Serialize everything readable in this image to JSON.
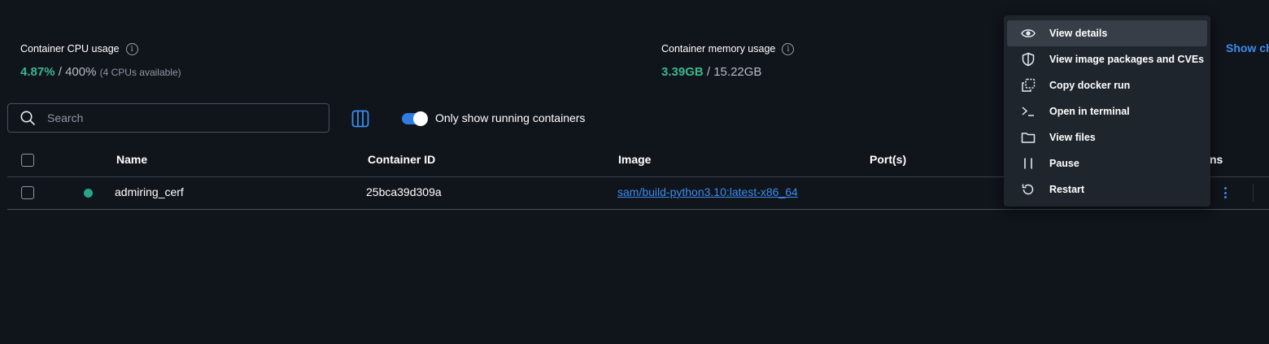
{
  "stats": {
    "cpu": {
      "title": "Container CPU usage",
      "value": "4.87%",
      "separator": " / ",
      "total": "400%",
      "note": "(4 CPUs available)"
    },
    "memory": {
      "title": "Container memory usage",
      "value": "3.39GB",
      "separator": " / ",
      "total": "15.22GB"
    },
    "info_icon_glyph": "i",
    "show_charts_label": "Show ch"
  },
  "toolbar": {
    "search_placeholder": "Search",
    "toggle_label": "Only show running containers",
    "toggle_on": true
  },
  "table": {
    "columns": {
      "name": "Name",
      "container_id": "Container ID",
      "image": "Image",
      "ports": "Port(s)",
      "actions_partial": "ns"
    },
    "rows": [
      {
        "name": "admiring_cerf",
        "container_id": "25bca39d309a",
        "image": "sam/build-python3.10:latest-x86_64",
        "ports": "",
        "status": "running"
      }
    ]
  },
  "context_menu": {
    "items": [
      {
        "label": "View details",
        "icon": "eye-icon",
        "active": true
      },
      {
        "label": "View image packages and CVEs",
        "icon": "shield-icon",
        "active": false
      },
      {
        "label": "Copy docker run",
        "icon": "copy-icon",
        "active": false
      },
      {
        "label": "Open in terminal",
        "icon": "terminal-icon",
        "active": false
      },
      {
        "label": "View files",
        "icon": "folder-icon",
        "active": false
      },
      {
        "label": "Pause",
        "icon": "pause-icon",
        "active": false
      },
      {
        "label": "Restart",
        "icon": "restart-icon",
        "active": false
      }
    ]
  },
  "colors": {
    "background": "#10141b",
    "accent": "#3b8cf0",
    "green": "#39b58e",
    "status_running": "#27a58a",
    "menu_bg": "#1f252d"
  }
}
